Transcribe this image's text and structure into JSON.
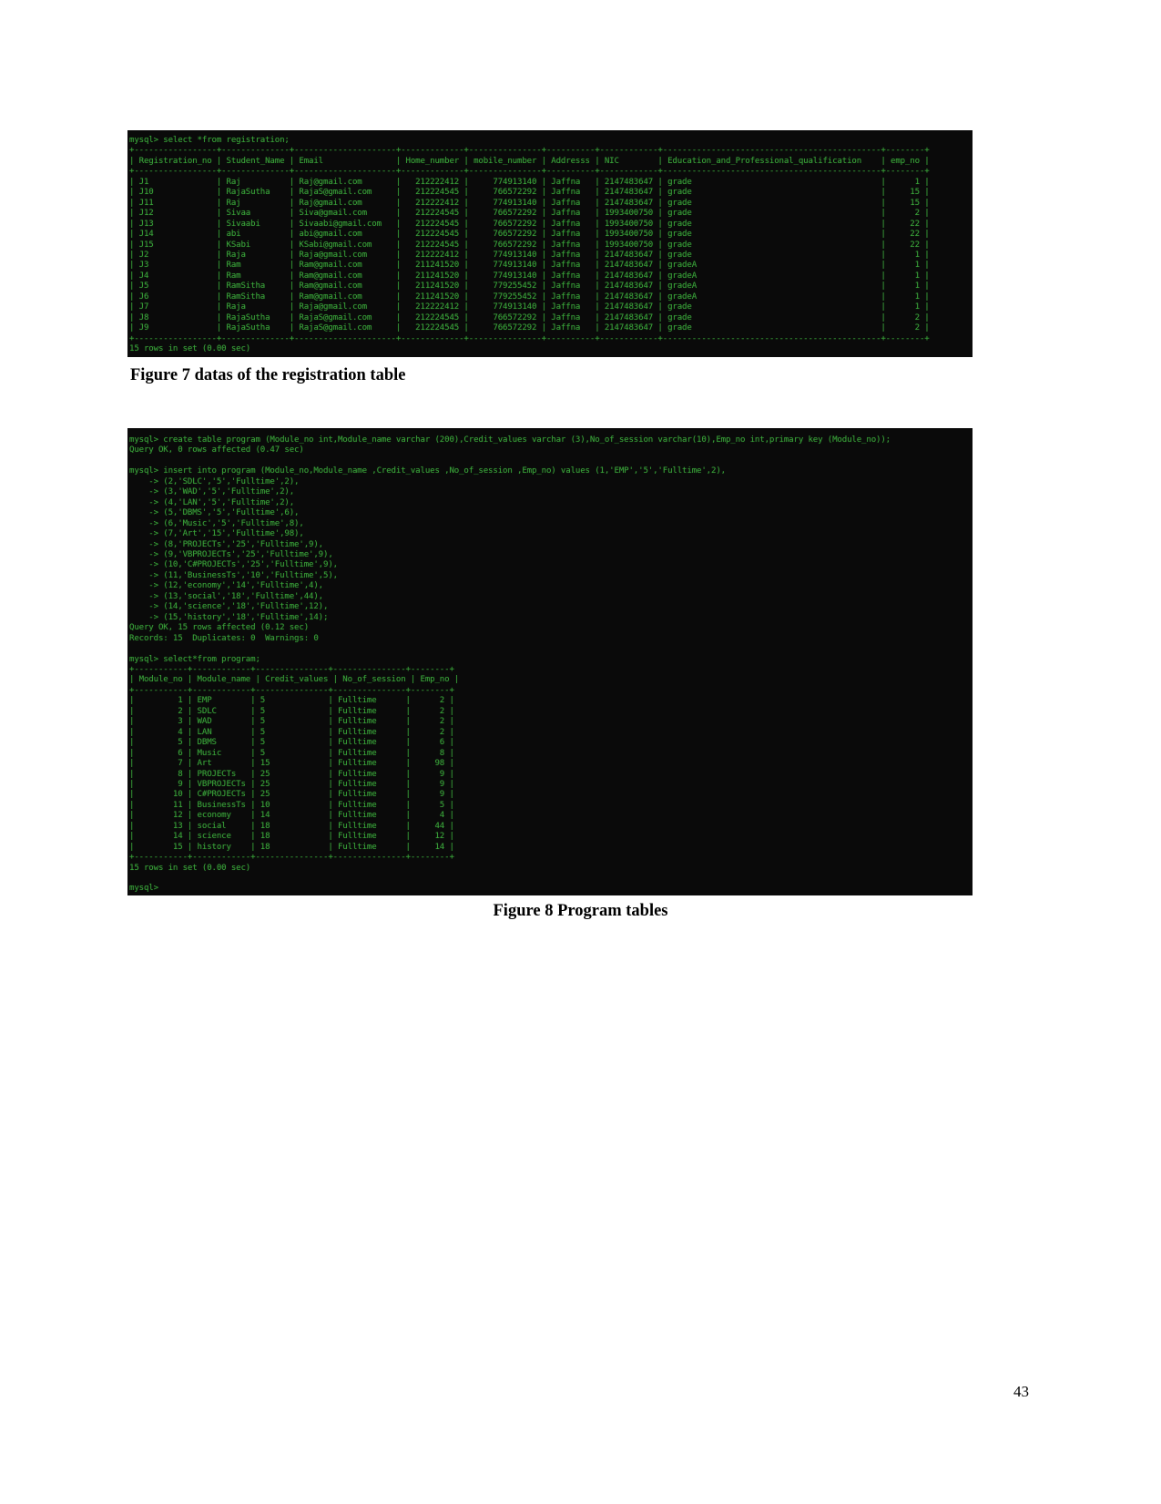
{
  "page": {
    "number": "43"
  },
  "figure7": {
    "caption": "Figure 7 datas of the registration table",
    "terminal_text": "mysql> select *from registration;\n+-----------------+--------------+---------------------+-------------+---------------+----------+------------+---------------------------------------------+--------+\n| Registration_no | Student_Name | Email               | Home_number | mobile_number | Addresss | NIC        | Education_and_Professional_qualification    | emp_no |\n+-----------------+--------------+---------------------+-------------+---------------+----------+------------+---------------------------------------------+--------+\n| J1              | Raj          | Raj@gmail.com       |   212222412 |     774913140 | Jaffna   | 2147483647 | grade                                       |      1 |\n| J10             | RajaSutha    | RajaS@gmail.com     |   212224545 |     766572292 | Jaffna   | 2147483647 | grade                                       |     15 |\n| J11             | Raj          | Raj@gmail.com       |   212222412 |     774913140 | Jaffna   | 2147483647 | grade                                       |     15 |\n| J12             | Sivaa        | Siva@gmail.com      |   212224545 |     766572292 | Jaffna   | 1993400750 | grade                                       |      2 |\n| J13             | Sivaabi      | Sivaabi@gmail.com   |   212224545 |     766572292 | Jaffna   | 1993400750 | grade                                       |     22 |\n| J14             | abi          | abi@gmail.com       |   212224545 |     766572292 | Jaffna   | 1993400750 | grade                                       |     22 |\n| J15             | KSabi        | KSabi@gmail.com     |   212224545 |     766572292 | Jaffna   | 1993400750 | grade                                       |     22 |\n| J2              | Raja         | Raja@gmail.com      |   212222412 |     774913140 | Jaffna   | 2147483647 | grade                                       |      1 |\n| J3              | Ram          | Ram@gmail.com       |   211241520 |     774913140 | Jaffna   | 2147483647 | gradeA                                      |      1 |\n| J4              | Ram          | Ram@gmail.com       |   211241520 |     774913140 | Jaffna   | 2147483647 | gradeA                                      |      1 |\n| J5              | RamSitha     | Ram@gmail.com       |   211241520 |     779255452 | Jaffna   | 2147483647 | gradeA                                      |      1 |\n| J6              | RamSitha     | Ram@gmail.com       |   211241520 |     779255452 | Jaffna   | 2147483647 | gradeA                                      |      1 |\n| J7              | Raja         | Raja@gmail.com      |   212222412 |     774913140 | Jaffna   | 2147483647 | grade                                       |      1 |\n| J8              | RajaSutha    | RajaS@gmail.com     |   212224545 |     766572292 | Jaffna   | 2147483647 | grade                                       |      2 |\n| J9              | RajaSutha    | RajaS@gmail.com     |   212224545 |     766572292 | Jaffna   | 2147483647 | grade                                       |      2 |\n+-----------------+--------------+---------------------+-------------+---------------+----------+------------+---------------------------------------------+--------+\n15 rows in set (0.00 sec)\n",
    "command": "select *from registration;",
    "prompt": "mysql>",
    "status": "15 rows in set (0.00 sec)",
    "columns": [
      "Registration_no",
      "Student_Name",
      "Email",
      "Home_number",
      "mobile_number",
      "Addresss",
      "NIC",
      "Education_and_Professional_qualification",
      "emp_no"
    ],
    "rows": [
      [
        "J1",
        "Raj",
        "Raj@gmail.com",
        "212222412",
        "774913140",
        "Jaffna",
        "2147483647",
        "grade",
        "1"
      ],
      [
        "J10",
        "RajaSutha",
        "RajaS@gmail.com",
        "212224545",
        "766572292",
        "Jaffna",
        "2147483647",
        "grade",
        "15"
      ],
      [
        "J11",
        "Raj",
        "Raj@gmail.com",
        "212222412",
        "774913140",
        "Jaffna",
        "2147483647",
        "grade",
        "15"
      ],
      [
        "J12",
        "Sivaa",
        "Siva@gmail.com",
        "212224545",
        "766572292",
        "Jaffna",
        "1993400750",
        "grade",
        "2"
      ],
      [
        "J13",
        "Sivaabi",
        "Sivaabi@gmail.com",
        "212224545",
        "766572292",
        "Jaffna",
        "1993400750",
        "grade",
        "22"
      ],
      [
        "J14",
        "abi",
        "abi@gmail.com",
        "212224545",
        "766572292",
        "Jaffna",
        "1993400750",
        "grade",
        "22"
      ],
      [
        "J15",
        "KSabi",
        "KSabi@gmail.com",
        "212224545",
        "766572292",
        "Jaffna",
        "1993400750",
        "grade",
        "22"
      ],
      [
        "J2",
        "Raja",
        "Raja@gmail.com",
        "212222412",
        "774913140",
        "Jaffna",
        "2147483647",
        "grade",
        "1"
      ],
      [
        "J3",
        "Ram",
        "Ram@gmail.com",
        "211241520",
        "774913140",
        "Jaffna",
        "2147483647",
        "gradeA",
        "1"
      ],
      [
        "J4",
        "Ram",
        "Ram@gmail.com",
        "211241520",
        "774913140",
        "Jaffna",
        "2147483647",
        "gradeA",
        "1"
      ],
      [
        "J5",
        "RamSitha",
        "Ram@gmail.com",
        "211241520",
        "779255452",
        "Jaffna",
        "2147483647",
        "gradeA",
        "1"
      ],
      [
        "J6",
        "RamSitha",
        "Ram@gmail.com",
        "211241520",
        "779255452",
        "Jaffna",
        "2147483647",
        "gradeA",
        "1"
      ],
      [
        "J7",
        "Raja",
        "Raja@gmail.com",
        "212222412",
        "774913140",
        "Jaffna",
        "2147483647",
        "grade",
        "1"
      ],
      [
        "J8",
        "RajaSutha",
        "RajaS@gmail.com",
        "212224545",
        "766572292",
        "Jaffna",
        "2147483647",
        "grade",
        "2"
      ],
      [
        "J9",
        "RajaSutha",
        "RajaS@gmail.com",
        "212224545",
        "766572292",
        "Jaffna",
        "2147483647",
        "grade",
        "2"
      ]
    ]
  },
  "figure8": {
    "caption": "Figure 8 Program tables",
    "terminal_text": "mysql> create table program (Module_no int,Module_name varchar (200),Credit_values varchar (3),No_of_session varchar(10),Emp_no int,primary key (Module_no));\nQuery OK, 0 rows affected (0.47 sec)\n\nmysql> insert into program (Module_no,Module_name ,Credit_values ,No_of_session ,Emp_no) values (1,'EMP','5','Fulltime',2),\n    -> (2,'SDLC','5','Fulltime',2),\n    -> (3,'WAD','5','Fulltime',2),\n    -> (4,'LAN','5','Fulltime',2),\n    -> (5,'DBMS','5','Fulltime',6),\n    -> (6,'Music','5','Fulltime',8),\n    -> (7,'Art','15','Fulltime',98),\n    -> (8,'PROJECTs','25','Fulltime',9),\n    -> (9,'VBPROJECTs','25','Fulltime',9),\n    -> (10,'C#PROJECTs','25','Fulltime',9),\n    -> (11,'BusinessTs','10','Fulltime',5),\n    -> (12,'economy','14','Fulltime',4),\n    -> (13,'social','18','Fulltime',44),\n    -> (14,'science','18','Fulltime',12),\n    -> (15,'history','18','Fulltime',14);\nQuery OK, 15 rows affected (0.12 sec)\nRecords: 15  Duplicates: 0  Warnings: 0\n\nmysql> select*from program;\n+-----------+------------+---------------+---------------+--------+\n| Module_no | Module_name | Credit_values | No_of_session | Emp_no |\n+-----------+------------+---------------+---------------+--------+\n|         1 | EMP        | 5             | Fulltime      |      2 |\n|         2 | SDLC       | 5             | Fulltime      |      2 |\n|         3 | WAD        | 5             | Fulltime      |      2 |\n|         4 | LAN        | 5             | Fulltime      |      2 |\n|         5 | DBMS       | 5             | Fulltime      |      6 |\n|         6 | Music      | 5             | Fulltime      |      8 |\n|         7 | Art        | 15            | Fulltime      |     98 |\n|         8 | PROJECTs   | 25            | Fulltime      |      9 |\n|         9 | VBPROJECTs | 25            | Fulltime      |      9 |\n|        10 | C#PROJECTs | 25            | Fulltime      |      9 |\n|        11 | BusinessTs | 10            | Fulltime      |      5 |\n|        12 | economy    | 14            | Fulltime      |      4 |\n|        13 | social     | 18            | Fulltime      |     44 |\n|        14 | science    | 18            | Fulltime      |     12 |\n|        15 | history    | 18            | Fulltime      |     14 |\n+-----------+------------+---------------+---------------+--------+\n15 rows in set (0.00 sec)\n\nmysql>",
    "create_statement": "create table program (Module_no int,Module_name varchar (200),Credit_values varchar (3),No_of_session varchar(10),Emp_no int,primary key (Module_no));",
    "create_result": "Query OK, 0 rows affected (0.47 sec)",
    "insert_statement": "insert into program (Module_no,Module_name ,Credit_values ,No_of_session ,Emp_no) values (1,'EMP','5','Fulltime',2),",
    "insert_continuation": [
      "(2,'SDLC','5','Fulltime',2),",
      "(3,'WAD','5','Fulltime',2),",
      "(4,'LAN','5','Fulltime',2),",
      "(5,'DBMS','5','Fulltime',6),",
      "(6,'Music','5','Fulltime',8),",
      "(7,'Art','15','Fulltime',98),",
      "(8,'PROJECTs','25','Fulltime',9),",
      "(9,'VBPROJECTs','25','Fulltime',9),",
      "(10,'C#PROJECTs','25','Fulltime',9),",
      "(11,'BusinessTs','10','Fulltime',5),",
      "(12,'economy','14','Fulltime',4),",
      "(13,'social','18','Fulltime',44),",
      "(14,'science','18','Fulltime',12),",
      "(15,'history','18','Fulltime',14);"
    ],
    "insert_result": "Query OK, 15 rows affected (0.12 sec)",
    "insert_records": "Records: 15  Duplicates: 0  Warnings: 0",
    "select_statement": "select*from program;",
    "status": "15 rows in set (0.00 sec)",
    "columns": [
      "Module_no",
      "Module_name",
      "Credit_values",
      "No_of_session",
      "Emp_no"
    ],
    "rows": [
      [
        "1",
        "EMP",
        "5",
        "Fulltime",
        "2"
      ],
      [
        "2",
        "SDLC",
        "5",
        "Fulltime",
        "2"
      ],
      [
        "3",
        "WAD",
        "5",
        "Fulltime",
        "2"
      ],
      [
        "4",
        "LAN",
        "5",
        "Fulltime",
        "2"
      ],
      [
        "5",
        "DBMS",
        "5",
        "Fulltime",
        "6"
      ],
      [
        "6",
        "Music",
        "5",
        "Fulltime",
        "8"
      ],
      [
        "7",
        "Art",
        "15",
        "Fulltime",
        "98"
      ],
      [
        "8",
        "PROJECTs",
        "25",
        "Fulltime",
        "9"
      ],
      [
        "9",
        "VBPROJECTs",
        "25",
        "Fulltime",
        "9"
      ],
      [
        "10",
        "C#PROJECTs",
        "25",
        "Fulltime",
        "9"
      ],
      [
        "11",
        "BusinessTs",
        "10",
        "Fulltime",
        "5"
      ],
      [
        "12",
        "economy",
        "14",
        "Fulltime",
        "4"
      ],
      [
        "13",
        "social",
        "18",
        "Fulltime",
        "44"
      ],
      [
        "14",
        "science",
        "18",
        "Fulltime",
        "12"
      ],
      [
        "15",
        "history",
        "18",
        "Fulltime",
        "14"
      ]
    ]
  },
  "colors": {
    "terminal_background": "#0a0a0a",
    "terminal_text": "#3aa33a",
    "page_background": "#ffffff",
    "caption_text": "#000000"
  }
}
